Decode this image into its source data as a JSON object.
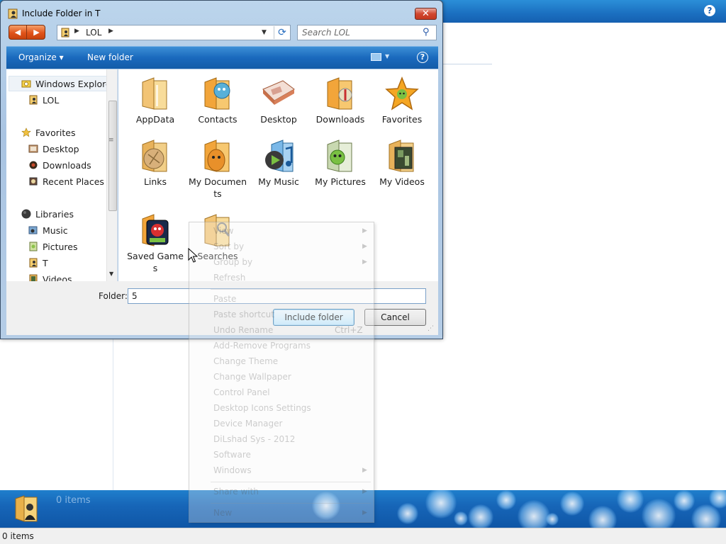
{
  "background_window": {
    "status_text": "0 items",
    "details_items_text": "0 items"
  },
  "dialog": {
    "title": "Include Folder in T",
    "close_label": "✕",
    "back_glyph": "◀",
    "forward_glyph": "▶",
    "address": {
      "crumb": "LOL"
    },
    "search_placeholder": "Search LOL",
    "toolbar": {
      "organize": "Organize ▾",
      "new_folder": "New folder",
      "help": "?"
    },
    "nav_items": [
      {
        "label": "Windows Explorer",
        "icon": "explorer-icon"
      },
      {
        "label": "LOL",
        "icon": "user-folder-icon"
      },
      {
        "label": "Favorites",
        "icon": "star-icon"
      },
      {
        "label": "Desktop",
        "icon": "desktop-icon"
      },
      {
        "label": "Downloads",
        "icon": "downloads-icon"
      },
      {
        "label": "Recent Places",
        "icon": "recent-places-icon"
      },
      {
        "label": "Libraries",
        "icon": "libraries-icon"
      },
      {
        "label": "Music",
        "icon": "music-icon"
      },
      {
        "label": "Pictures",
        "icon": "pictures-icon"
      },
      {
        "label": "T",
        "icon": "library-folder-icon"
      },
      {
        "label": "Videos",
        "icon": "videos-icon"
      }
    ],
    "folders": [
      {
        "label": "AppData",
        "icon": "folder-icon",
        "color": "#e9b45a"
      },
      {
        "label": "Contacts",
        "icon": "contacts-icon",
        "color": "#f0a020"
      },
      {
        "label": "Desktop",
        "icon": "desktop-folder-icon",
        "color": "#d89060"
      },
      {
        "label": "Downloads",
        "icon": "downloads-folder-icon",
        "color": "#f0a020"
      },
      {
        "label": "Favorites",
        "icon": "favorites-star-icon",
        "color": "#f5a623"
      },
      {
        "label": "Links",
        "icon": "links-folder-icon",
        "color": "#e0a84a"
      },
      {
        "label": "My Documents",
        "icon": "documents-folder-icon",
        "color": "#e08a20"
      },
      {
        "label": "My Music",
        "icon": "music-folder-icon",
        "color": "#3a8fd0"
      },
      {
        "label": "My Pictures",
        "icon": "pictures-folder-icon",
        "color": "#8bc34a"
      },
      {
        "label": "My Videos",
        "icon": "videos-folder-icon",
        "color": "#4a6a3a"
      },
      {
        "label": "Saved Games",
        "icon": "saved-games-icon",
        "color": "#c83030"
      },
      {
        "label": "Searches",
        "icon": "searches-folder-icon",
        "color": "#e9b45a"
      }
    ],
    "folder_field": {
      "label": "Folder:",
      "value": "5"
    },
    "buttons": {
      "include": "Include folder",
      "cancel": "Cancel"
    }
  },
  "context_menu": {
    "items": [
      {
        "label": "View",
        "submenu": true
      },
      {
        "label": "Sort by",
        "submenu": true
      },
      {
        "label": "Group by",
        "submenu": true
      },
      {
        "label": "Refresh"
      },
      {
        "label": "Paste"
      },
      {
        "label": "Paste shortcut"
      },
      {
        "label": "Undo Rename",
        "shortcut": "Ctrl+Z"
      },
      {
        "label": "Add-Remove Programs"
      },
      {
        "label": "Change Theme"
      },
      {
        "label": "Change Wallpaper"
      },
      {
        "label": "Control Panel"
      },
      {
        "label": "Desktop Icons Settings"
      },
      {
        "label": "Device Manager"
      },
      {
        "label": "DiLshad Sys - 2012"
      },
      {
        "label": "Software"
      },
      {
        "label": "Windows",
        "submenu": true
      },
      {
        "label": "Share with",
        "submenu": true
      },
      {
        "label": "New",
        "submenu": true
      }
    ]
  },
  "colors": {
    "titlebar": "#1b6fc0",
    "toolbar": "#1a69bd",
    "close_button": "#d1472f",
    "nav_buttons": "#e0531a"
  }
}
